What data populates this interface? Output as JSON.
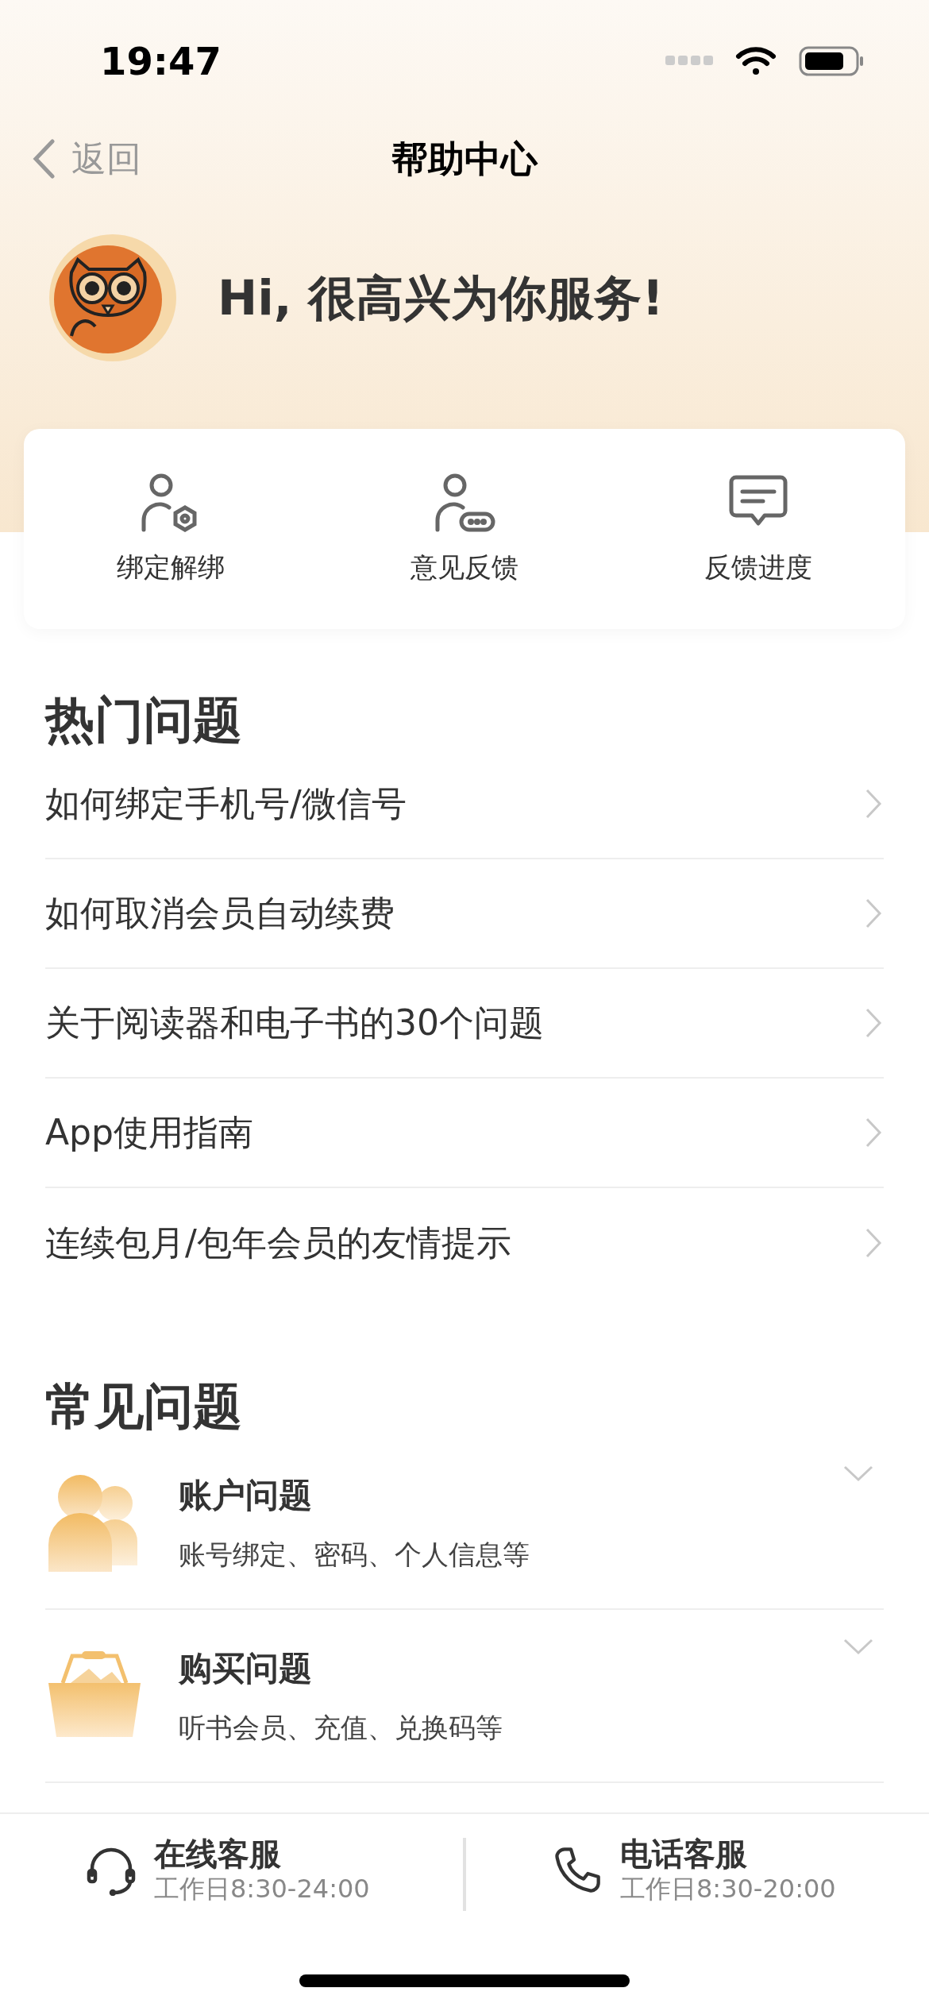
{
  "status_bar": {
    "time": "19:47"
  },
  "nav": {
    "back": "返回",
    "title": "帮助中心"
  },
  "greeting": "Hi, 很高兴为你服务!",
  "quick_actions": [
    {
      "kind": "bind",
      "label": "绑定解绑"
    },
    {
      "kind": "feedback",
      "label": "意见反馈"
    },
    {
      "kind": "progress",
      "label": "反馈进度"
    }
  ],
  "hot_questions": {
    "title": "热门问题",
    "items": [
      "如何绑定手机号/微信号",
      "如何取消会员自动续费",
      "关于阅读器和电子书的30个问题",
      "App使用指南",
      "连续包月/包年会员的友情提示"
    ]
  },
  "common_questions": {
    "title": "常见问题",
    "items": [
      {
        "kind": "account",
        "title": "账户问题",
        "subtitle": "账号绑定、密码、个人信息等",
        "expanded": false
      },
      {
        "kind": "purchase",
        "title": "购买问题",
        "subtitle": "听书会员、充值、兑换码等",
        "expanded": false
      }
    ]
  },
  "support": [
    {
      "kind": "online",
      "title": "在线客服",
      "hours": "工作日8:30-24:00"
    },
    {
      "kind": "phone",
      "title": "电话客服",
      "hours": "工作日8:30-20:00"
    }
  ]
}
